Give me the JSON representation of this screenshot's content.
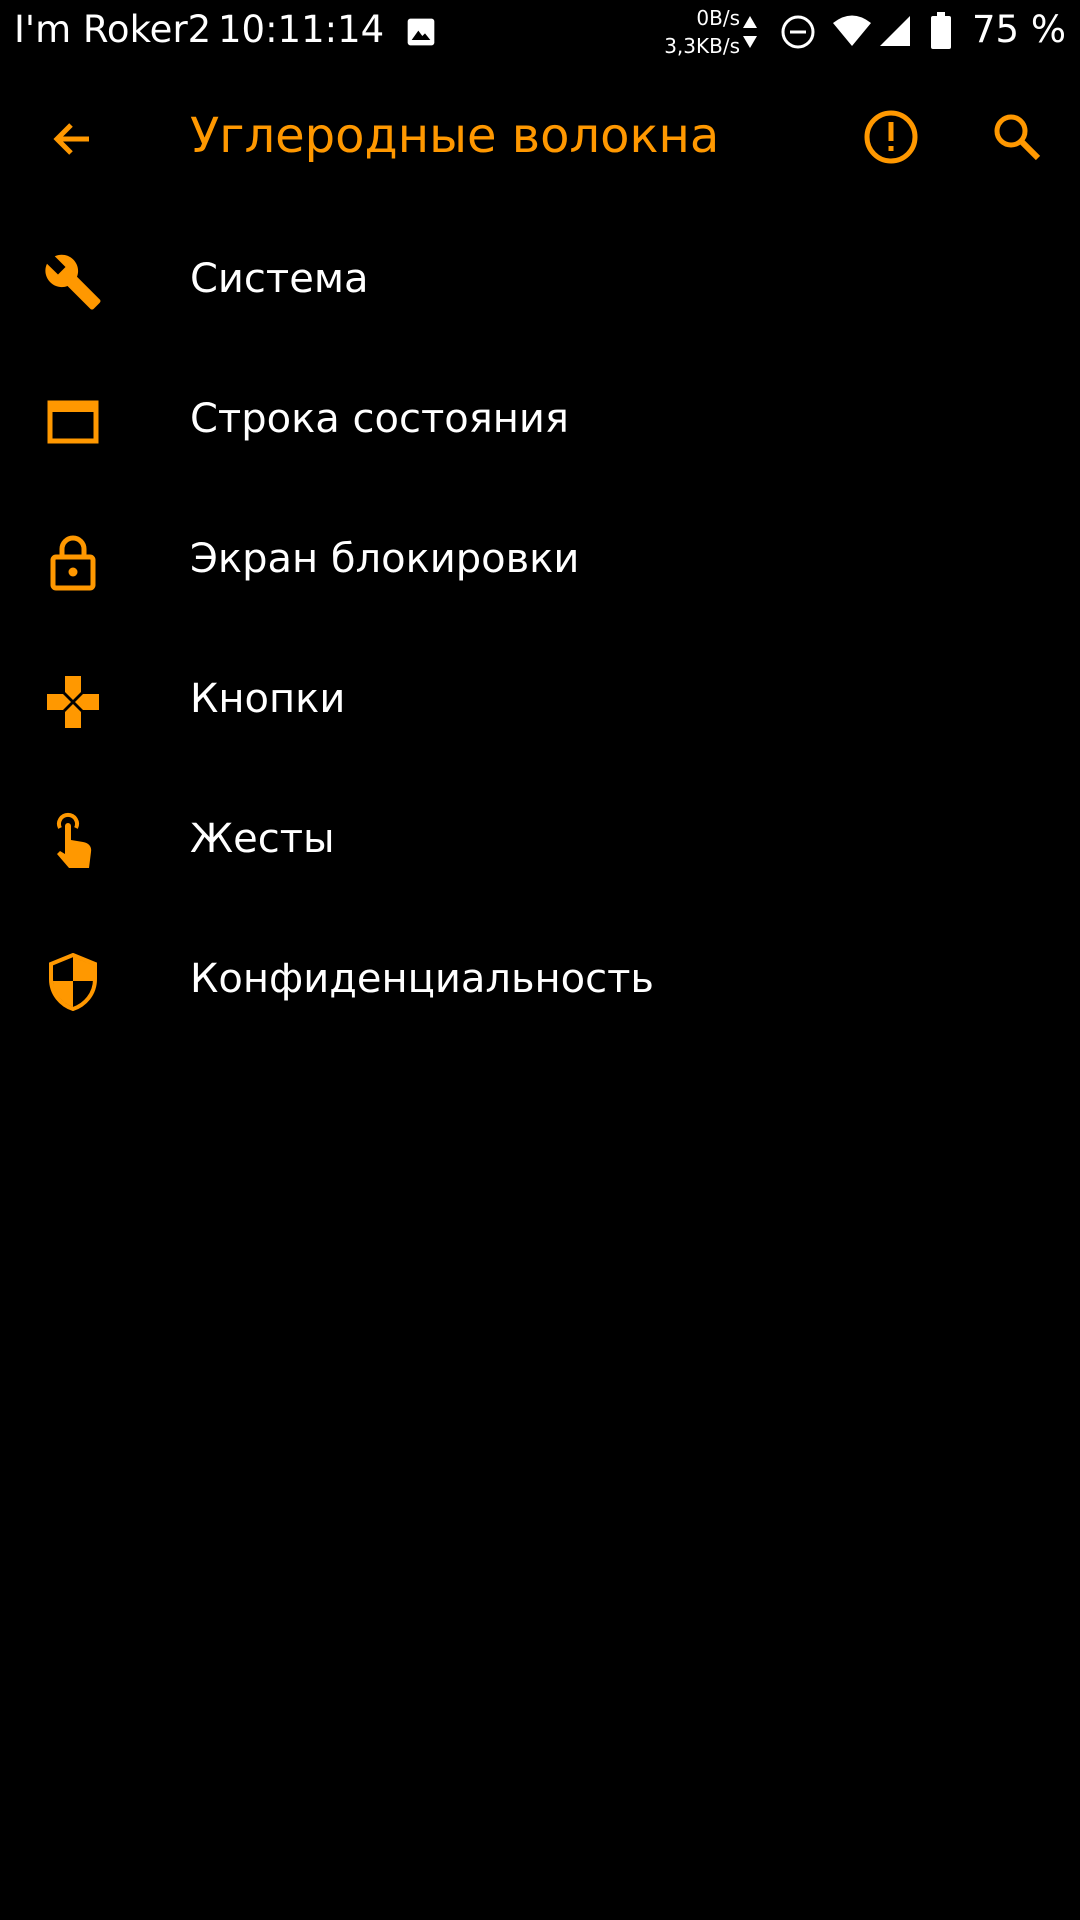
{
  "status_bar": {
    "carrier": "I'm Roker2",
    "time": "10:11:14",
    "net_up": "0B/s",
    "net_down": "3,3KB/s",
    "battery": "75 %",
    "icons": [
      "gallery-icon",
      "data-arrows-icon",
      "do-not-disturb-icon",
      "wifi-icon",
      "signal-icon",
      "battery-icon"
    ]
  },
  "app_bar": {
    "title": "Углеродные волокна",
    "icons": [
      "back-arrow-icon",
      "alert-circle-icon",
      "search-icon"
    ]
  },
  "menu": {
    "items": [
      {
        "label": "Система",
        "icon": "wrench-icon"
      },
      {
        "label": "Строка состояния",
        "icon": "statusbar-window-icon"
      },
      {
        "label": "Экран блокировки",
        "icon": "lock-icon"
      },
      {
        "label": "Кнопки",
        "icon": "dpad-buttons-icon"
      },
      {
        "label": "Жесты",
        "icon": "touch-gesture-icon"
      },
      {
        "label": "Конфиденциальность",
        "icon": "shield-icon"
      }
    ]
  },
  "colors": {
    "accent": "#ff9800",
    "background": "#000000",
    "text": "#ffffff"
  }
}
